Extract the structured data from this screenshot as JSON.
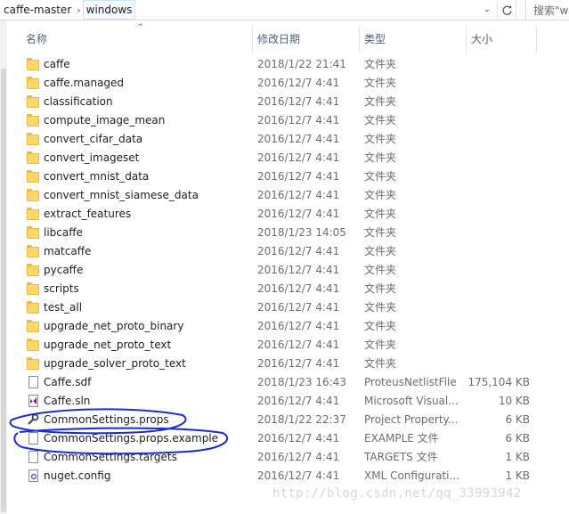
{
  "breadcrumb": [
    "caffe-master",
    "windows"
  ],
  "search": {
    "placeholder": "搜索\"wi"
  },
  "columns": {
    "name": "名称",
    "date": "修改日期",
    "type": "类型",
    "size": "大小"
  },
  "files": [
    {
      "name": "caffe",
      "date": "2018/1/22 21:41",
      "type": "文件夹",
      "size": "",
      "icon": "folder-icon"
    },
    {
      "name": "caffe.managed",
      "date": "2016/12/7 4:41",
      "type": "文件夹",
      "size": "",
      "icon": "folder-icon"
    },
    {
      "name": "classification",
      "date": "2016/12/7 4:41",
      "type": "文件夹",
      "size": "",
      "icon": "folder-icon"
    },
    {
      "name": "compute_image_mean",
      "date": "2016/12/7 4:41",
      "type": "文件夹",
      "size": "",
      "icon": "folder-icon"
    },
    {
      "name": "convert_cifar_data",
      "date": "2016/12/7 4:41",
      "type": "文件夹",
      "size": "",
      "icon": "folder-icon"
    },
    {
      "name": "convert_imageset",
      "date": "2016/12/7 4:41",
      "type": "文件夹",
      "size": "",
      "icon": "folder-icon"
    },
    {
      "name": "convert_mnist_data",
      "date": "2016/12/7 4:41",
      "type": "文件夹",
      "size": "",
      "icon": "folder-icon"
    },
    {
      "name": "convert_mnist_siamese_data",
      "date": "2016/12/7 4:41",
      "type": "文件夹",
      "size": "",
      "icon": "folder-icon"
    },
    {
      "name": "extract_features",
      "date": "2016/12/7 4:41",
      "type": "文件夹",
      "size": "",
      "icon": "folder-icon"
    },
    {
      "name": "libcaffe",
      "date": "2018/1/23 14:05",
      "type": "文件夹",
      "size": "",
      "icon": "folder-icon"
    },
    {
      "name": "matcaffe",
      "date": "2016/12/7 4:41",
      "type": "文件夹",
      "size": "",
      "icon": "folder-icon"
    },
    {
      "name": "pycaffe",
      "date": "2016/12/7 4:41",
      "type": "文件夹",
      "size": "",
      "icon": "folder-icon"
    },
    {
      "name": "scripts",
      "date": "2016/12/7 4:41",
      "type": "文件夹",
      "size": "",
      "icon": "folder-icon"
    },
    {
      "name": "test_all",
      "date": "2016/12/7 4:41",
      "type": "文件夹",
      "size": "",
      "icon": "folder-icon"
    },
    {
      "name": "upgrade_net_proto_binary",
      "date": "2016/12/7 4:41",
      "type": "文件夹",
      "size": "",
      "icon": "folder-icon"
    },
    {
      "name": "upgrade_net_proto_text",
      "date": "2016/12/7 4:41",
      "type": "文件夹",
      "size": "",
      "icon": "folder-icon"
    },
    {
      "name": "upgrade_solver_proto_text",
      "date": "2016/12/7 4:41",
      "type": "文件夹",
      "size": "",
      "icon": "folder-icon"
    },
    {
      "name": "Caffe.sdf",
      "date": "2018/1/23 16:43",
      "type": "ProteusNetlistFile",
      "size": "175,104 KB",
      "icon": "file-icon"
    },
    {
      "name": "Caffe.sln",
      "date": "2016/12/7 4:41",
      "type": "Microsoft Visual...",
      "size": "10 KB",
      "icon": "visual-studio-solution-icon"
    },
    {
      "name": "CommonSettings.props",
      "date": "2018/1/22 22:37",
      "type": "Project Property...",
      "size": "6 KB",
      "icon": "wrench-icon"
    },
    {
      "name": "CommonSettings.props.example",
      "date": "2016/12/7 4:41",
      "type": "EXAMPLE 文件",
      "size": "6 KB",
      "icon": "file-icon"
    },
    {
      "name": "CommonSettings.targets",
      "date": "2016/12/7 4:41",
      "type": "TARGETS 文件",
      "size": "1 KB",
      "icon": "file-icon"
    },
    {
      "name": "nuget.config",
      "date": "2016/12/7 4:41",
      "type": "XML Configurati...",
      "size": "1 KB",
      "icon": "config-file-icon"
    }
  ],
  "watermark": "http://blog.csdn.net/qq_33993942",
  "colors": {
    "annotation_ink": "#1a2bd6",
    "folder": "#ffd766",
    "header_text": "#4c607a"
  }
}
